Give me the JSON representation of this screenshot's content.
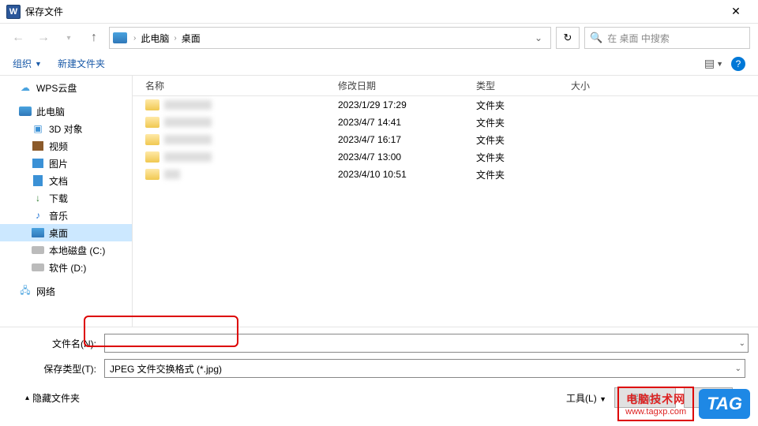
{
  "title": "保存文件",
  "breadcrumb": {
    "seg1": "此电脑",
    "seg2": "桌面"
  },
  "search": {
    "placeholder": "在 桌面 中搜索"
  },
  "toolbar": {
    "organize": "组织",
    "newfolder": "新建文件夹"
  },
  "sidebar": {
    "items": [
      {
        "label": "WPS云盘"
      },
      {
        "label": "此电脑"
      },
      {
        "label": "3D 对象"
      },
      {
        "label": "视频"
      },
      {
        "label": "图片"
      },
      {
        "label": "文档"
      },
      {
        "label": "下载"
      },
      {
        "label": "音乐"
      },
      {
        "label": "桌面"
      },
      {
        "label": "本地磁盘 (C:)"
      },
      {
        "label": "软件 (D:)"
      },
      {
        "label": "网络"
      }
    ]
  },
  "columns": {
    "name": "名称",
    "date": "修改日期",
    "type": "类型",
    "size": "大小"
  },
  "rows": [
    {
      "date": "2023/1/29 17:29",
      "type": "文件夹"
    },
    {
      "date": "2023/4/7 14:41",
      "type": "文件夹"
    },
    {
      "date": "2023/4/7 16:17",
      "type": "文件夹"
    },
    {
      "date": "2023/4/7 13:00",
      "type": "文件夹"
    },
    {
      "date": "2023/4/10 10:51",
      "type": "文件夹"
    }
  ],
  "fields": {
    "filename_label": "文件名(N):",
    "filename_value": "",
    "savetype_label": "保存类型(T):",
    "savetype_value": "JPEG 文件交换格式 (*.jpg)"
  },
  "footer": {
    "hide": "隐藏文件夹",
    "tools": "工具(L)",
    "save": "保存(S)",
    "cancel": "取消"
  },
  "watermark": {
    "site": "电脑技术网",
    "url": "www.tagxp.com",
    "tag": "TAG"
  }
}
